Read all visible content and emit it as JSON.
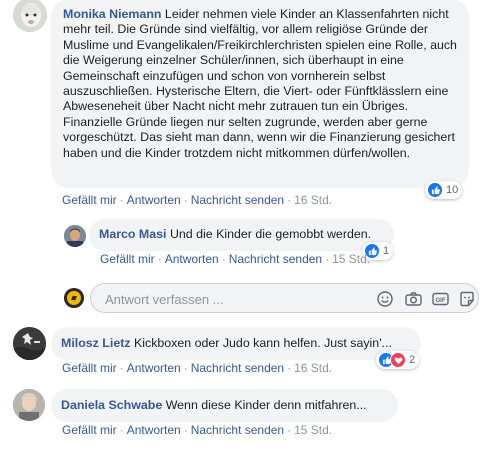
{
  "comments": [
    {
      "author": "Monika Niemann",
      "text": "Leider nehmen viele Kinder an Klassenfahrten nicht mehr teil. Die Gründe sind vielfältig, vor allem religiöse Gründe der Muslime und Evangelikalen/Freikirchlerchristen spielen eine Rolle, auch die Weigerung einzelner Schüler/innen, sich überhaupt in eine Gemeinschaft einzufügen und schon von vornherein selbst auszuschließen. Hysterische Eltern, die Viert- oder Fünftklässlern eine Abweseneheit über Nacht nicht mehr zutrauen tun ein Übriges. Finanzielle Gründe liegen nur selten zugrunde, werden aber gerne vorgeschützt. Das sieht man dann, wenn wir die Finanzierung gesichert haben und die Kinder trotzdem nicht mitkommen dürfen/wollen.",
      "like": "Gefällt mir",
      "reply": "Antworten",
      "message": "Nachricht senden",
      "time": "16 Std.",
      "reaction_count": "10"
    },
    {
      "author": "Marco Masi",
      "text": "Und die Kinder die gemobbt werden.",
      "like": "Gefällt mir",
      "reply": "Antworten",
      "message": "Nachricht senden",
      "time": "15 Std.",
      "reaction_count": "1"
    },
    {
      "author": "Milosz Lietz",
      "text": "Kickboxen oder Judo kann helfen. Just sayin'...",
      "like": "Gefällt mir",
      "reply": "Antworten",
      "message": "Nachricht senden",
      "time": "16 Std.",
      "reaction_count": "2"
    },
    {
      "author": "Daniela Schwabe",
      "text": "Wenn diese Kinder denn mitfahren...",
      "like": "Gefällt mir",
      "reply": "Antworten",
      "message": "Nachricht senden",
      "time": "15 Std."
    }
  ],
  "reply_box": {
    "placeholder": "Antwort verfassen ..."
  },
  "separator": "·",
  "colors": {
    "link": "#385898",
    "meta": "#90949c",
    "bubble": "#f2f3f5",
    "like": "#1877f2",
    "love": "#f33e58"
  },
  "icons": {
    "reply_tools": [
      "emoji-icon",
      "camera-icon",
      "gif-icon",
      "sticker-icon"
    ]
  }
}
